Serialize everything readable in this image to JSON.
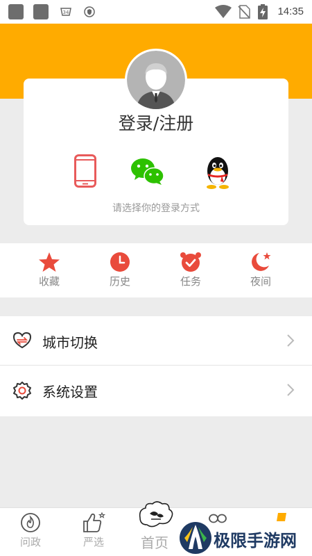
{
  "status_bar": {
    "time": "14:35",
    "icons": [
      "app-icon",
      "app-icon",
      "notification-icon",
      "shield-icon",
      "wifi-icon",
      "no-sim-icon",
      "battery-charging-icon"
    ]
  },
  "login": {
    "title": "登录/注册",
    "hint": "请选择你的登录方式",
    "methods": [
      "phone-icon",
      "wechat-icon",
      "qq-icon"
    ]
  },
  "quick_actions": [
    {
      "label": "收藏",
      "icon": "star-icon"
    },
    {
      "label": "历史",
      "icon": "clock-icon"
    },
    {
      "label": "任务",
      "icon": "alarm-icon"
    },
    {
      "label": "夜间",
      "icon": "moon-icon"
    }
  ],
  "menu": [
    {
      "label": "城市切换",
      "icon": "city-switch-icon"
    },
    {
      "label": "系统设置",
      "icon": "settings-gear-icon"
    }
  ],
  "bottom_nav": {
    "items": [
      {
        "label": "问政",
        "icon": "fire-badge-icon"
      },
      {
        "label": "严选",
        "icon": "thumbs-up-icon"
      },
      {
        "label": "首页",
        "icon": "home-icon"
      }
    ]
  },
  "watermark": {
    "text": "极限手游网"
  },
  "colors": {
    "accent": "#ffab00",
    "quick_action_red": "#e94b3c",
    "background": "#ececec",
    "wechat_green": "#2dc100",
    "phone_red": "#e85a5a"
  }
}
